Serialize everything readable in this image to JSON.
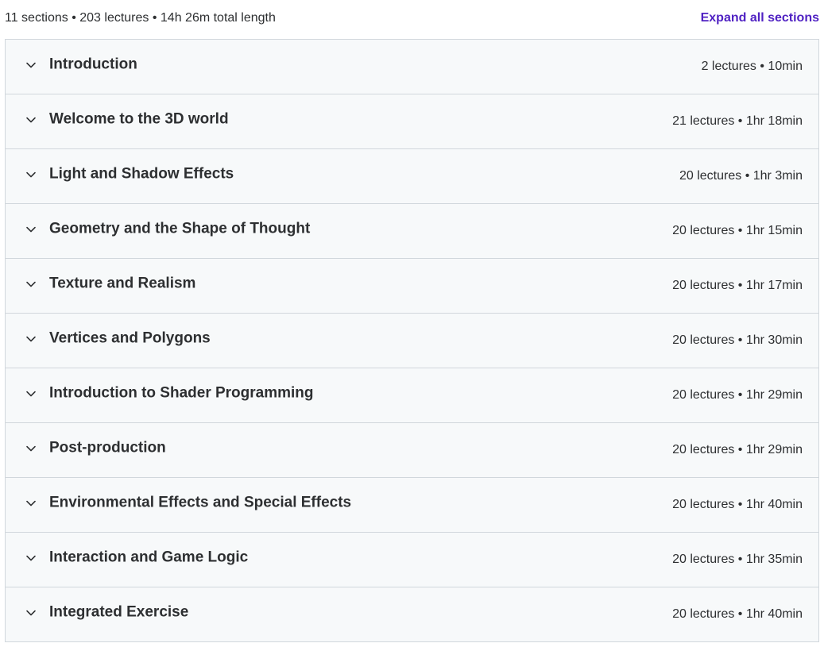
{
  "summary": {
    "text": "11 sections • 203 lectures • 14h 26m total length",
    "expand_label": "Expand all sections"
  },
  "icons": {
    "section_toggle": "chevron-down-icon"
  },
  "colors": {
    "accent": "#5022c3",
    "section_bg": "#f7f9fa",
    "border": "#d1d7dc",
    "text": "#2d2f31"
  },
  "sections": [
    {
      "title": "Introduction",
      "meta": "2 lectures • 10min"
    },
    {
      "title": "Welcome to the 3D world",
      "meta": "21 lectures • 1hr 18min"
    },
    {
      "title": "Light and Shadow Effects",
      "meta": "20 lectures • 1hr 3min"
    },
    {
      "title": "Geometry and the Shape of Thought",
      "meta": "20 lectures • 1hr 15min"
    },
    {
      "title": "Texture and Realism",
      "meta": "20 lectures • 1hr 17min"
    },
    {
      "title": "Vertices and Polygons",
      "meta": "20 lectures • 1hr 30min"
    },
    {
      "title": "Introduction to Shader Programming",
      "meta": "20 lectures • 1hr 29min"
    },
    {
      "title": "Post-production",
      "meta": "20 lectures • 1hr 29min"
    },
    {
      "title": "Environmental Effects and Special Effects",
      "meta": "20 lectures • 1hr 40min"
    },
    {
      "title": "Interaction and Game Logic",
      "meta": "20 lectures • 1hr 35min"
    },
    {
      "title": "Integrated Exercise",
      "meta": "20 lectures • 1hr 40min"
    }
  ]
}
